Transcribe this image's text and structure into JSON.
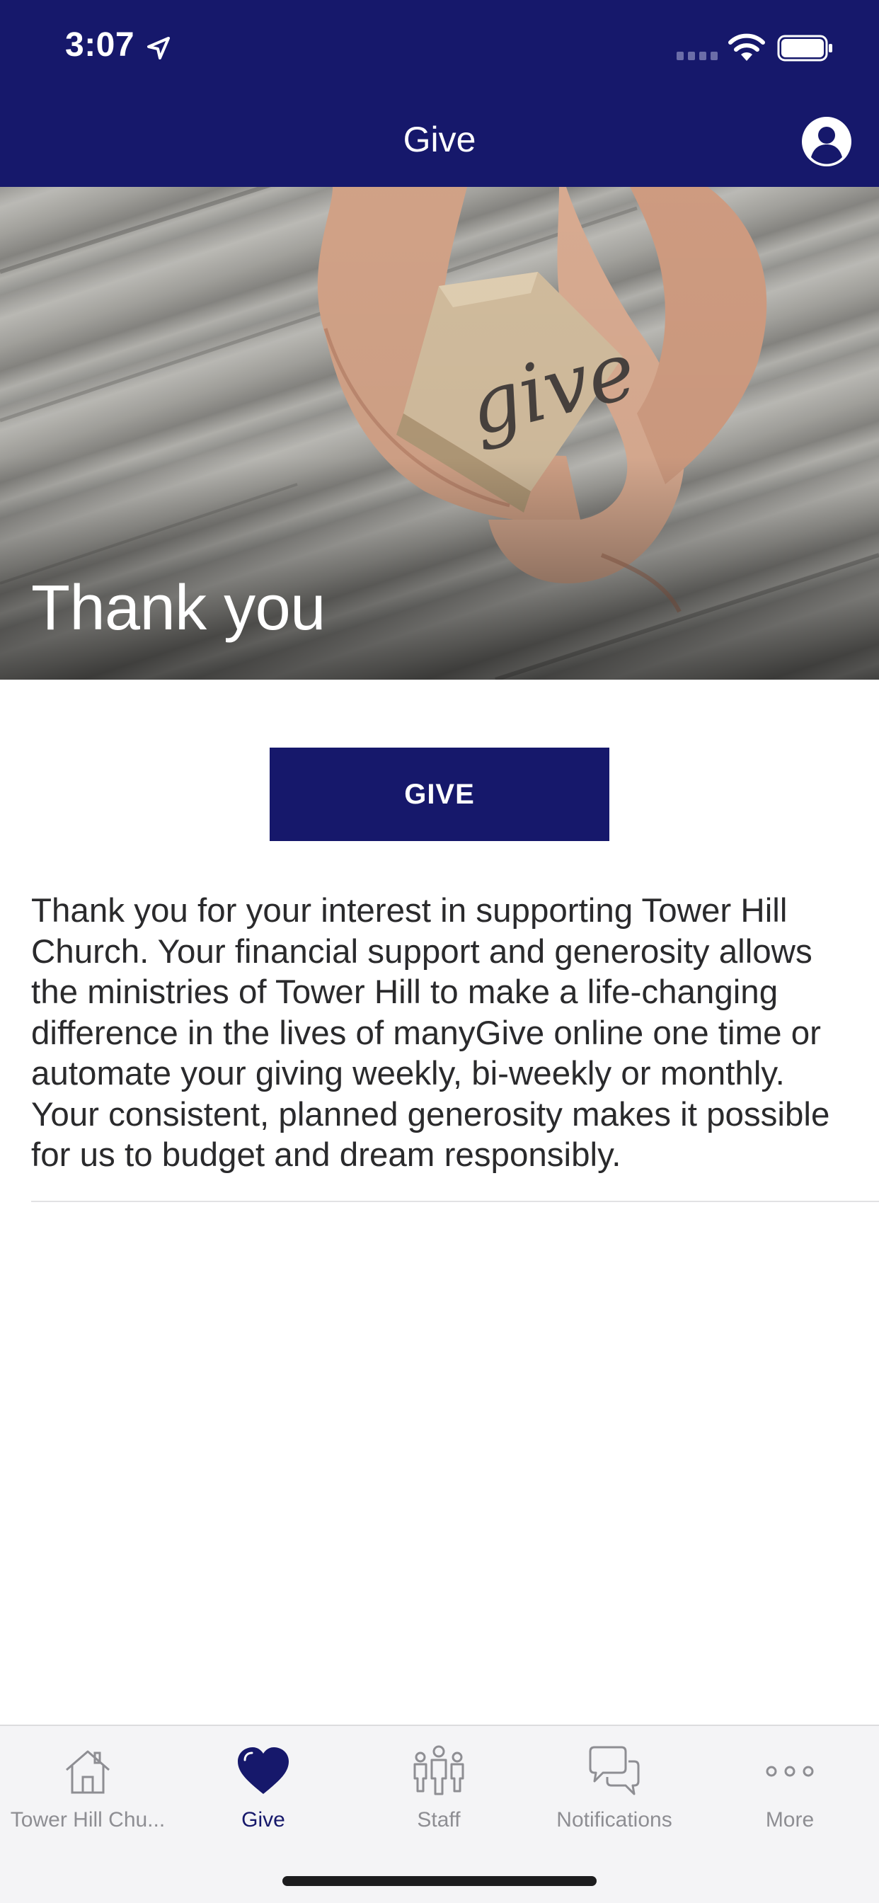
{
  "status_bar": {
    "time": "3:07"
  },
  "nav": {
    "title": "Give",
    "profile_icon": "person-circle-icon"
  },
  "hero": {
    "title": "Thank you",
    "image_text": "give"
  },
  "give_button": {
    "label": "GIVE"
  },
  "description": "Thank you for your interest in supporting Tower Hill Church. Your financial support and generosity allows the ministries of Tower Hill to make a life-changing difference in the lives of manyGive online one time or automate your giving weekly, bi-weekly or monthly. Your consistent, planned generosity makes it possible for us to budget and dream responsibly.",
  "tabs": [
    {
      "label": "Tower Hill Chu...",
      "icon": "home-icon",
      "active": false
    },
    {
      "label": "Give",
      "icon": "heart-icon",
      "active": true
    },
    {
      "label": "Staff",
      "icon": "people-icon",
      "active": false
    },
    {
      "label": "Notifications",
      "icon": "chat-bubbles-icon",
      "active": false
    },
    {
      "label": "More",
      "icon": "more-dots-icon",
      "active": false
    }
  ],
  "colors": {
    "brand": "#16186b",
    "tab_inactive": "#8e8e93",
    "tab_bar_bg": "#f4f4f6"
  }
}
